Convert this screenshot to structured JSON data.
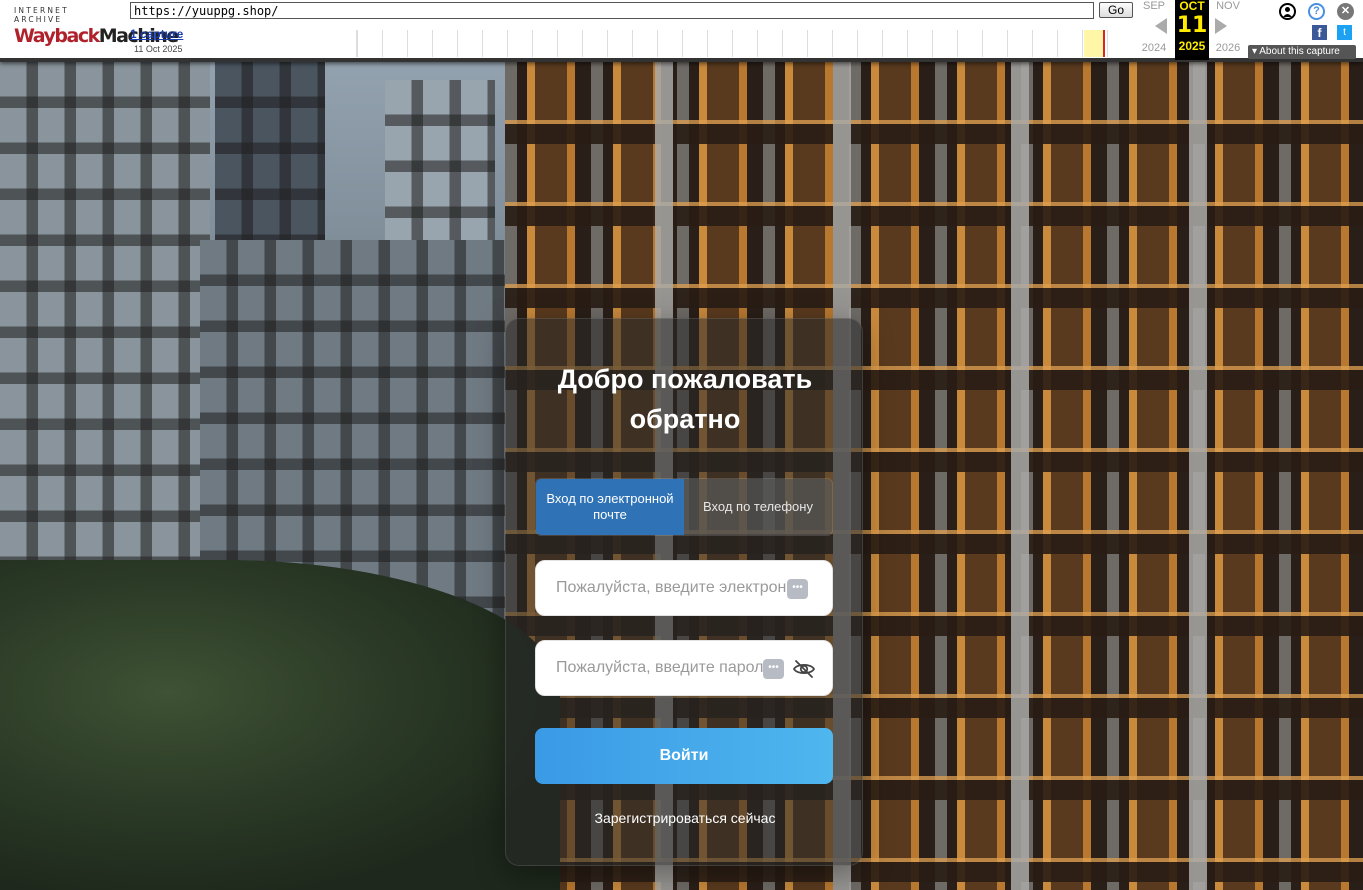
{
  "wayback": {
    "logo_top": "INTERNET ARCHIVE",
    "logo_wayback": "Wayback",
    "logo_machine": "Machine",
    "url": "https://yuuppg.shop/",
    "go_label": "Go",
    "captures_link": "1 capture",
    "capture_date": "11 Oct 2025",
    "prev_month": "SEP",
    "cur_month": "OCT",
    "next_month": "NOV",
    "cur_day": "11",
    "prev_year": "2024",
    "cur_year": "2025",
    "next_year": "2026",
    "about_label": "About this capture",
    "help_glyph": "?",
    "close_glyph": "✕",
    "fb_glyph": "f",
    "tw_glyph": "t"
  },
  "login": {
    "title": "Добро пожаловать обратно",
    "tabs": [
      {
        "label": "Вход по электронной почте",
        "active": true
      },
      {
        "label": "Вход по телефону",
        "active": false
      }
    ],
    "email_placeholder": "Пожалуйста, введите электронную почту",
    "password_placeholder": "Пожалуйста, введите пароль",
    "password_dots": "•••",
    "email_dots": "•••",
    "submit_label": "Войти",
    "register_label": "Зарегистрироваться сейчас"
  },
  "colors": {
    "accent": "#2f72b6",
    "button_gradient_start": "#3a9ae6",
    "button_gradient_end": "#4fb6ee",
    "wayback_highlight": "#ffea00"
  },
  "icons": {
    "password_toggle": "eye-off-icon",
    "user": "user-icon",
    "help": "help-icon",
    "close": "close-icon"
  }
}
